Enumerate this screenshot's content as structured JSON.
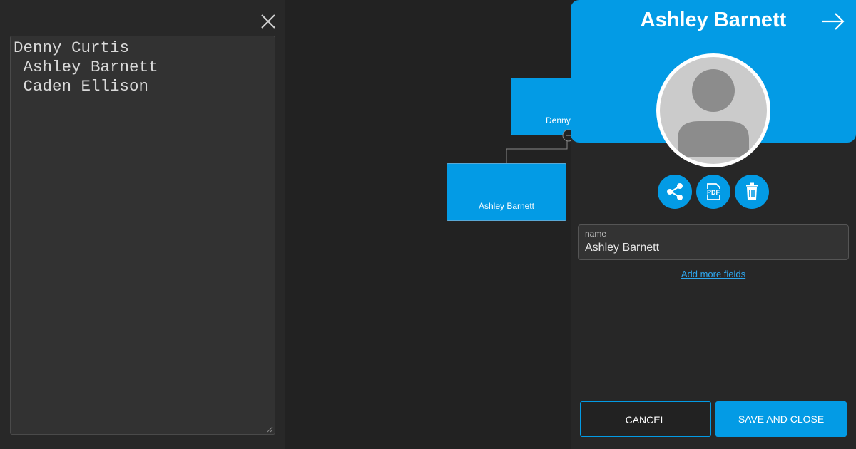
{
  "editor": {
    "text": "Denny Curtis\n Ashley Barnett\n Caden Ellison"
  },
  "canvas": {
    "nodes": [
      {
        "name": "Denny"
      },
      {
        "name": "Ashley Barnett"
      }
    ]
  },
  "form": {
    "title": "Ashley Barnett",
    "fields": [
      {
        "label": "name",
        "value": "Ashley Barnett"
      }
    ],
    "add_more_label": "Add more fields",
    "cancel_label": "CANCEL",
    "save_label": "SAVE AND CLOSE",
    "actions": [
      {
        "icon": "share-icon"
      },
      {
        "icon": "pdf-icon",
        "text": "PDF"
      },
      {
        "icon": "trash-icon"
      }
    ]
  },
  "colors": {
    "accent": "#039be5",
    "background": "#232323"
  }
}
